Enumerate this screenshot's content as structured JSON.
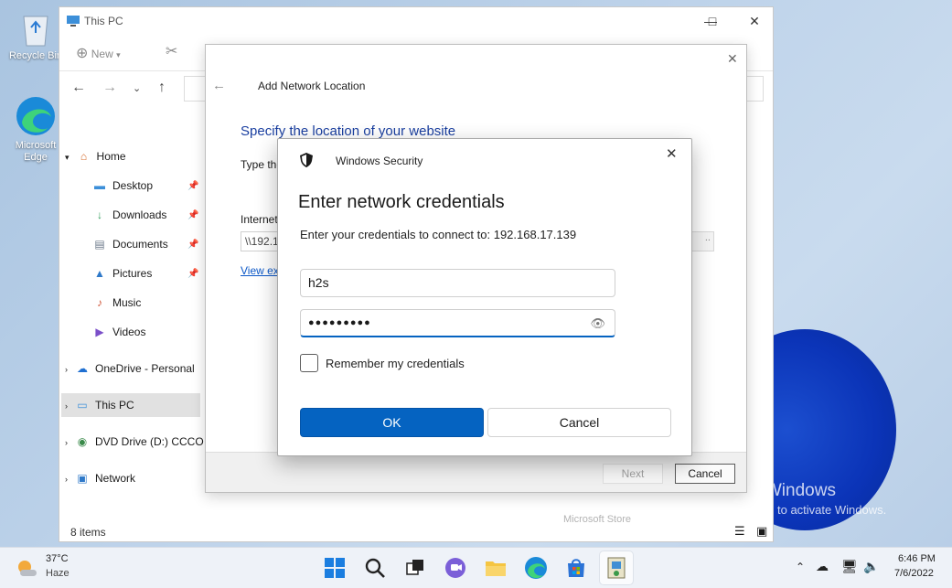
{
  "desktop": {
    "icons": [
      {
        "label": "Recycle Bin"
      },
      {
        "label": "Microsoft Edge"
      }
    ],
    "watermark": {
      "title": "Activate Windows",
      "subtitle": "Go to Settings to activate Windows."
    }
  },
  "explorer": {
    "title": "This PC",
    "toolbar": {
      "new_label": "New"
    },
    "nav": {
      "home": "Home",
      "quick": [
        "Desktop",
        "Downloads",
        "Documents",
        "Pictures",
        "Music",
        "Videos"
      ],
      "onedrive": "OneDrive - Personal",
      "thispc": "This PC",
      "dvd": "DVD Drive (D:) CCCO",
      "network": "Network"
    },
    "status": "8 items",
    "tooltip_fragment": "Microsoft Store"
  },
  "wizard": {
    "title": "Add Network Location",
    "heading": "Specify the location of your website",
    "type_label_fragment": "Type the",
    "internet_label_fragment": "Internet",
    "address_fragment": "\\\\192.1",
    "link_fragment": "View ex",
    "browse_fragment": "..",
    "next_label": "Next",
    "cancel_label": "Cancel"
  },
  "security": {
    "title": "Windows Security",
    "heading": "Enter network credentials",
    "prompt": "Enter your credentials to connect to: 192.168.17.139",
    "username": "h2s",
    "password_mask": "●●●●●●●●●",
    "remember_label": "Remember my credentials",
    "remember_checked": false,
    "ok_label": "OK",
    "cancel_label": "Cancel",
    "accent": "#0563c1"
  },
  "taskbar": {
    "weather": {
      "temp": "37°C",
      "condition": "Haze"
    },
    "time": "6:46 PM",
    "date": "7/6/2022"
  }
}
